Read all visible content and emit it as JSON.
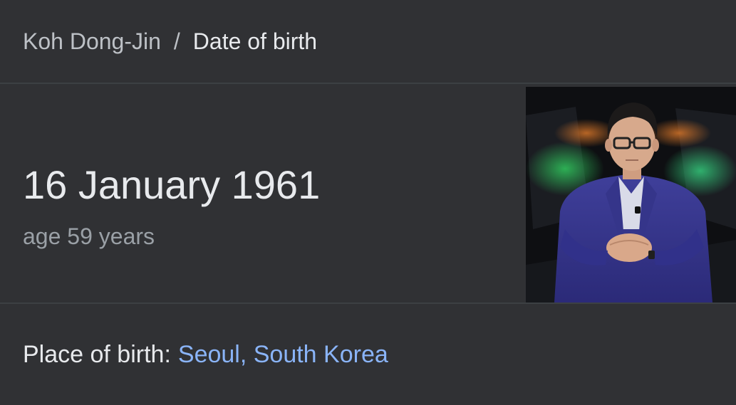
{
  "breadcrumb": {
    "entity": "Koh Dong-Jin",
    "separator": "/",
    "attribute": "Date of birth"
  },
  "answer": {
    "date": "16 January 1961",
    "age": "age 59 years"
  },
  "place_of_birth": {
    "label": "Place of birth:",
    "value": "Seoul, South Korea"
  },
  "photo": {
    "icon": "person-photo"
  },
  "colors": {
    "background": "#303134",
    "divider": "#3c4043",
    "primary_text": "#e8eaed",
    "secondary_text": "#9aa0a6",
    "link": "#8ab4f8"
  }
}
